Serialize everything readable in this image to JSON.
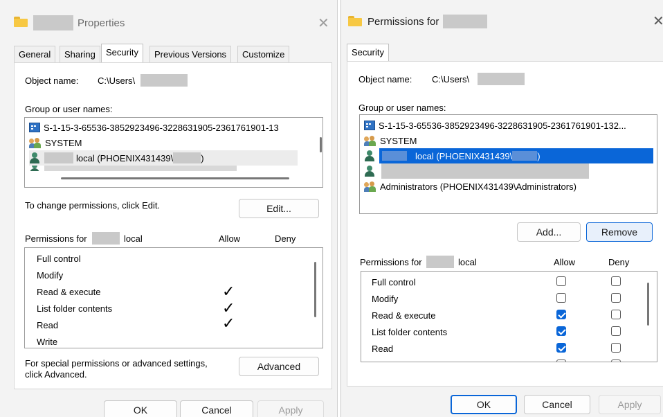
{
  "left_dialog": {
    "title": "Properties",
    "tabs": [
      "General",
      "Sharing",
      "Security",
      "Previous Versions",
      "Customize"
    ],
    "active_tab": "Security",
    "object_name_label": "Object name:",
    "object_name_value": "C:\\Users\\",
    "group_label": "Group or user names:",
    "users": [
      {
        "icon": "sid-icon",
        "label": "S-1-15-3-65536-3852923496-3228631905-2361761901-13"
      },
      {
        "icon": "group-icon",
        "label": "SYSTEM"
      },
      {
        "icon": "user-icon",
        "label": "local (PHOENIX431439\\",
        "suffix": ")"
      }
    ],
    "change_perm_text": "To change permissions, click Edit.",
    "edit_button": "Edit...",
    "perm_header": {
      "prefix": "Permissions for",
      "suffix": "local",
      "allow": "Allow",
      "deny": "Deny"
    },
    "permissions": [
      {
        "name": "Full control",
        "allow": false,
        "deny": false
      },
      {
        "name": "Modify",
        "allow": false,
        "deny": false
      },
      {
        "name": "Read & execute",
        "allow": true,
        "deny": false
      },
      {
        "name": "List folder contents",
        "allow": true,
        "deny": false
      },
      {
        "name": "Read",
        "allow": true,
        "deny": false
      },
      {
        "name": "Write",
        "allow": false,
        "deny": false
      }
    ],
    "special_text_1": "For special permissions or advanced settings,",
    "special_text_2": "click Advanced.",
    "advanced_button": "Advanced",
    "ok_button": "OK",
    "cancel_button": "Cancel",
    "apply_button": "Apply"
  },
  "right_dialog": {
    "title": "Permissions for",
    "tab": "Security",
    "object_name_label": "Object name:",
    "object_name_value": "C:\\Users\\",
    "group_label": "Group or user names:",
    "users": [
      {
        "icon": "sid-icon",
        "label": "S-1-15-3-65536-3852923496-3228631905-2361761901-132..."
      },
      {
        "icon": "group-icon",
        "label": "SYSTEM"
      },
      {
        "icon": "user-icon",
        "label": "local (PHOENIX431439\\",
        "suffix": ")",
        "selected": true
      },
      {
        "icon": "user-icon",
        "label": ""
      },
      {
        "icon": "group-icon",
        "label": "Administrators (PHOENIX431439\\Administrators)"
      }
    ],
    "add_button": "Add...",
    "remove_button": "Remove",
    "perm_header": {
      "prefix": "Permissions for",
      "suffix": "local",
      "allow": "Allow",
      "deny": "Deny"
    },
    "permissions": [
      {
        "name": "Full control",
        "allow": false,
        "deny": false
      },
      {
        "name": "Modify",
        "allow": false,
        "deny": false
      },
      {
        "name": "Read & execute",
        "allow": true,
        "deny": false
      },
      {
        "name": "List folder contents",
        "allow": true,
        "deny": false
      },
      {
        "name": "Read",
        "allow": true,
        "deny": false
      }
    ],
    "ok_button": "OK",
    "cancel_button": "Cancel",
    "apply_button": "Apply"
  },
  "colors": {
    "accent": "#0a66d8",
    "selection_text": "#ffffff",
    "dialog_bg": "#f3f3f3"
  }
}
